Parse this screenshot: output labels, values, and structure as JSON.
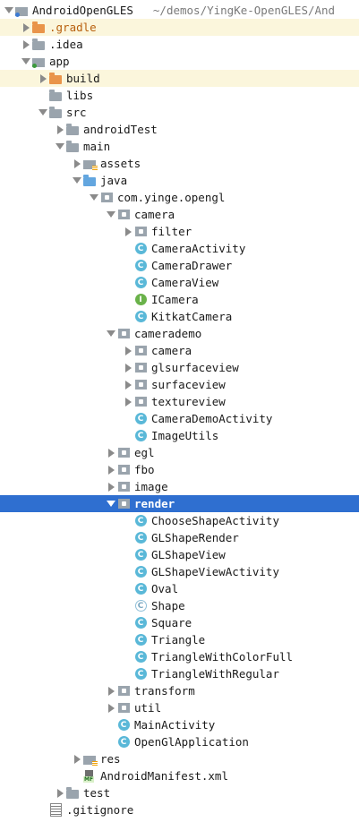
{
  "tree": {
    "rows": [
      {
        "label": "AndroidOpenGLES",
        "path": "~/demos/YingKe-OpenGLES/And",
        "depth": 0,
        "arrow": "down",
        "icon": "module-icon"
      },
      {
        "label": ".gradle",
        "depth": 1,
        "arrow": "right",
        "icon": "folder-orange-icon",
        "highlight": "yellow",
        "label_color": "orange"
      },
      {
        "label": ".idea",
        "depth": 1,
        "arrow": "right",
        "icon": "folder-icon"
      },
      {
        "label": "app",
        "depth": 1,
        "arrow": "down",
        "icon": "module-icon"
      },
      {
        "label": "build",
        "depth": 2,
        "arrow": "right",
        "icon": "folder-orange-icon",
        "highlight": "yellow"
      },
      {
        "label": "libs",
        "depth": 2,
        "arrow": "none",
        "icon": "folder-icon"
      },
      {
        "label": "src",
        "depth": 2,
        "arrow": "down",
        "icon": "folder-icon"
      },
      {
        "label": "androidTest",
        "depth": 3,
        "arrow": "right",
        "icon": "folder-icon"
      },
      {
        "label": "main",
        "depth": 3,
        "arrow": "down",
        "icon": "folder-icon"
      },
      {
        "label": "assets",
        "depth": 4,
        "arrow": "right",
        "icon": "assets-folder-icon"
      },
      {
        "label": "java",
        "depth": 4,
        "arrow": "down",
        "icon": "folder-blue-icon"
      },
      {
        "label": "com.yinge.opengl",
        "depth": 5,
        "arrow": "down",
        "icon": "package-icon"
      },
      {
        "label": "camera",
        "depth": 6,
        "arrow": "down",
        "icon": "package-icon"
      },
      {
        "label": "filter",
        "depth": 7,
        "arrow": "right",
        "icon": "package-icon"
      },
      {
        "label": "CameraActivity",
        "depth": 7,
        "arrow": "none",
        "icon": "class-icon"
      },
      {
        "label": "CameraDrawer",
        "depth": 7,
        "arrow": "none",
        "icon": "class-icon"
      },
      {
        "label": "CameraView",
        "depth": 7,
        "arrow": "none",
        "icon": "class-icon"
      },
      {
        "label": "ICamera",
        "depth": 7,
        "arrow": "none",
        "icon": "interface-icon"
      },
      {
        "label": "KitkatCamera",
        "depth": 7,
        "arrow": "none",
        "icon": "class-icon"
      },
      {
        "label": "camerademo",
        "depth": 6,
        "arrow": "down",
        "icon": "package-icon"
      },
      {
        "label": "camera",
        "depth": 7,
        "arrow": "right",
        "icon": "package-icon"
      },
      {
        "label": "glsurfaceview",
        "depth": 7,
        "arrow": "right",
        "icon": "package-icon"
      },
      {
        "label": "surfaceview",
        "depth": 7,
        "arrow": "right",
        "icon": "package-icon"
      },
      {
        "label": "textureview",
        "depth": 7,
        "arrow": "right",
        "icon": "package-icon"
      },
      {
        "label": "CameraDemoActivity",
        "depth": 7,
        "arrow": "none",
        "icon": "class-icon"
      },
      {
        "label": "ImageUtils",
        "depth": 7,
        "arrow": "none",
        "icon": "class-icon"
      },
      {
        "label": "egl",
        "depth": 6,
        "arrow": "right",
        "icon": "package-icon"
      },
      {
        "label": "fbo",
        "depth": 6,
        "arrow": "right",
        "icon": "package-icon"
      },
      {
        "label": "image",
        "depth": 6,
        "arrow": "right",
        "icon": "package-icon"
      },
      {
        "label": "render",
        "depth": 6,
        "arrow": "down",
        "icon": "package-icon",
        "selected": true
      },
      {
        "label": "ChooseShapeActivity",
        "depth": 7,
        "arrow": "none",
        "icon": "class-icon"
      },
      {
        "label": "GLShapeRender",
        "depth": 7,
        "arrow": "none",
        "icon": "class-icon"
      },
      {
        "label": "GLShapeView",
        "depth": 7,
        "arrow": "none",
        "icon": "class-icon"
      },
      {
        "label": "GLShapeViewActivity",
        "depth": 7,
        "arrow": "none",
        "icon": "class-icon"
      },
      {
        "label": "Oval",
        "depth": 7,
        "arrow": "none",
        "icon": "class-icon"
      },
      {
        "label": "Shape",
        "depth": 7,
        "arrow": "none",
        "icon": "abstract-class-icon"
      },
      {
        "label": "Square",
        "depth": 7,
        "arrow": "none",
        "icon": "class-icon"
      },
      {
        "label": "Triangle",
        "depth": 7,
        "arrow": "none",
        "icon": "class-icon"
      },
      {
        "label": "TriangleWithColorFull",
        "depth": 7,
        "arrow": "none",
        "icon": "class-icon"
      },
      {
        "label": "TriangleWithRegular",
        "depth": 7,
        "arrow": "none",
        "icon": "class-icon"
      },
      {
        "label": "transform",
        "depth": 6,
        "arrow": "right",
        "icon": "package-icon"
      },
      {
        "label": "util",
        "depth": 6,
        "arrow": "right",
        "icon": "package-icon"
      },
      {
        "label": "MainActivity",
        "depth": 6,
        "arrow": "none",
        "icon": "class-icon"
      },
      {
        "label": "OpenGlApplication",
        "depth": 6,
        "arrow": "none",
        "icon": "class-icon"
      },
      {
        "label": "res",
        "depth": 4,
        "arrow": "right",
        "icon": "res-folder-icon"
      },
      {
        "label": "AndroidManifest.xml",
        "depth": 4,
        "arrow": "none",
        "icon": "manifest-icon"
      },
      {
        "label": "test",
        "depth": 3,
        "arrow": "right",
        "icon": "folder-icon"
      },
      {
        "label": ".gitignore",
        "depth": 2,
        "arrow": "none",
        "icon": "text-file-icon"
      }
    ]
  },
  "colors": {
    "selection": "#2f6fd0",
    "highlight_yellow": "#fbf6dc",
    "class_icon": "#5ab8d8",
    "interface_icon": "#6ab24a",
    "folder_orange": "#e9944a",
    "folder_blue": "#63a6df"
  }
}
